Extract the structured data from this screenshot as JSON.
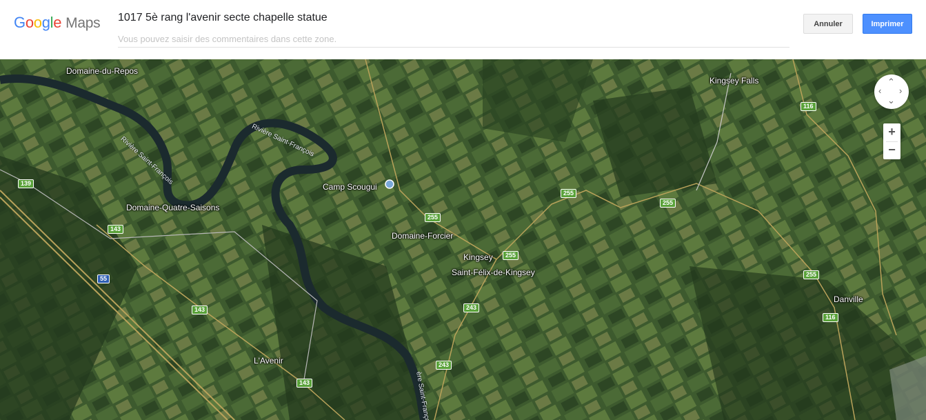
{
  "header": {
    "logo_google": [
      "G",
      "o",
      "o",
      "g",
      "l",
      "e"
    ],
    "logo_colors": [
      "#4285F4",
      "#EA4335",
      "#FBBC05",
      "#4285F4",
      "#34A853",
      "#EA4335"
    ],
    "logo_maps": "Maps",
    "title": "1017 5è rang l'avenir secte chapelle statue",
    "comment_placeholder": "Vous pouvez saisir des commentaires dans cette zone.",
    "cancel_label": "Annuler",
    "print_label": "Imprimer"
  },
  "map": {
    "view": "satellite",
    "places": {
      "domaine_du_repos": "Domaine-du-Repos",
      "kingsey_falls": "Kingsey Falls",
      "camp_scougui": "Camp Scougui",
      "domaine_quatre_saisons": "Domaine-Quatre-Saisons",
      "domaine_forcier": "Domaine-Forcier",
      "kingsey": "Kingsey",
      "saint_felix": "Saint-Félix-de-Kingsey",
      "danville": "Danville",
      "l_avenir": "L'Avenir"
    },
    "rivers": {
      "r1": "Rivière Saint-François",
      "r2": "Rivière Saint-François",
      "r3": "ère Saint-François"
    },
    "routes": {
      "r116a": "116",
      "r139": "139",
      "r143a": "143",
      "r55": "55",
      "r143b": "143",
      "r143c": "143",
      "r255a": "255",
      "r255b": "255",
      "r255c": "255",
      "r255d": "255",
      "r255e": "255",
      "r243a": "243",
      "r243b": "243",
      "r116b": "116"
    },
    "controls": {
      "zoom_in": "+",
      "zoom_out": "−",
      "pan_up": "⌃",
      "pan_down": "⌄",
      "pan_left": "‹",
      "pan_right": "›"
    }
  }
}
